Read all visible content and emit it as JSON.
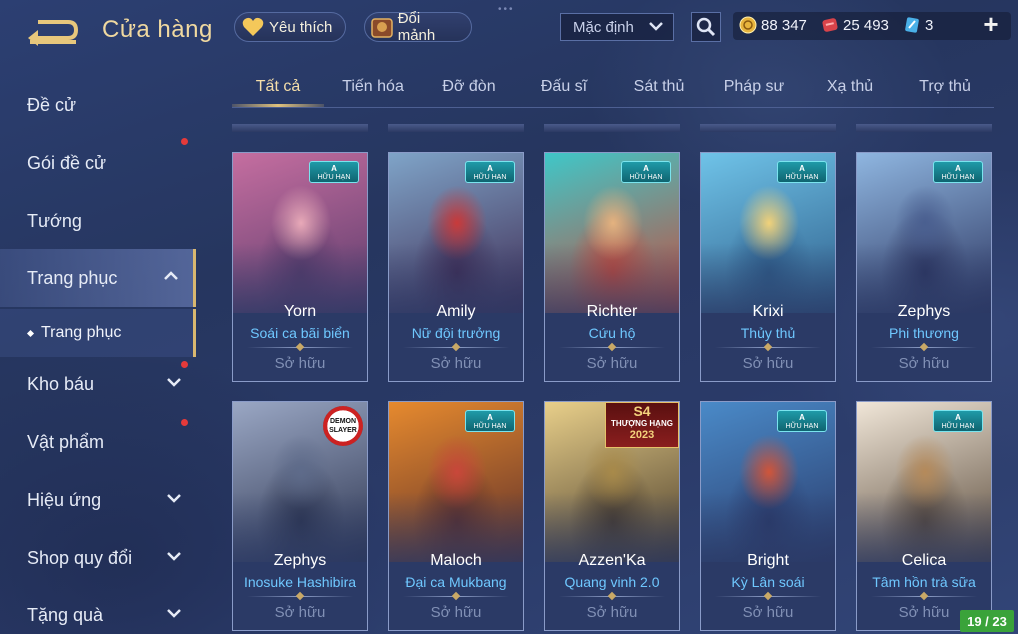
{
  "header": {
    "title": "Cửa hàng",
    "favorites_label": "Yêu thích",
    "shard_exchange_label": "Đổi mảnh",
    "sort": {
      "selected": "Mặc định"
    },
    "currencies": [
      {
        "name": "gold-coin",
        "value": "88 347"
      },
      {
        "name": "ruby-voucher",
        "value": "25 493"
      },
      {
        "name": "skin-ticket",
        "value": "3"
      }
    ]
  },
  "sidebar": {
    "items": [
      {
        "label": "Đề cử"
      },
      {
        "label": "Gói đề cử"
      },
      {
        "label": "Tướng"
      },
      {
        "label": "Trang phục"
      },
      {
        "label": "Kho báu"
      },
      {
        "label": "Vật phẩm"
      },
      {
        "label": "Hiệu ứng"
      },
      {
        "label": "Shop quy đổi"
      },
      {
        "label": "Tặng quà"
      }
    ],
    "sub_item": {
      "label": "Trang phục"
    }
  },
  "tabs": [
    "Tất cả",
    "Tiến hóa",
    "Đỡ đòn",
    "Đấu sĩ",
    "Sát thủ",
    "Pháp sư",
    "Xạ thủ",
    "Trợ thủ"
  ],
  "badges": {
    "limited_rank": "A",
    "limited_text": "HỮU HẠN",
    "demon_slayer": "DEMON SLAYER",
    "season": {
      "s": "S4",
      "t": "THƯỢNG HẠNG",
      "y": "2023"
    }
  },
  "cards": [
    {
      "hero": "Yorn",
      "skin": "Soái ca bãi biển",
      "status": "Sở hữu",
      "badge": "limited",
      "colors": [
        "#c56ea0",
        "#e8a9b8",
        "#5a3b6b"
      ]
    },
    {
      "hero": "Amily",
      "skin": "Nữ đội trưởng",
      "status": "Sở hữu",
      "badge": "limited",
      "colors": [
        "#7fa4c8",
        "#c93a3a",
        "#3f2c54"
      ]
    },
    {
      "hero": "Richter",
      "skin": "Cứu hộ",
      "status": "Sở hữu",
      "badge": "limited",
      "colors": [
        "#3fc7c8",
        "#e4b27f",
        "#c84a3a"
      ]
    },
    {
      "hero": "Krixi",
      "skin": "Thủy thủ",
      "status": "Sở hữu",
      "badge": "limited",
      "colors": [
        "#6fc3e8",
        "#f1d27a",
        "#2e5d8a"
      ]
    },
    {
      "hero": "Zephys",
      "skin": "Phi thương",
      "status": "Sở hữu",
      "badge": "limited",
      "colors": [
        "#8fb6e0",
        "#4a5f90",
        "#2c3560"
      ]
    },
    {
      "hero": "Zephys",
      "skin": "Inosuke Hashibira",
      "status": "Sở hữu",
      "badge": "demon",
      "colors": [
        "#9aa7c4",
        "#5e6b8a",
        "#2d3550"
      ]
    },
    {
      "hero": "Maloch",
      "skin": "Đại ca Mukbang",
      "status": "Sở hữu",
      "badge": "limited",
      "colors": [
        "#e68a2e",
        "#c9473a",
        "#5c2e2a"
      ]
    },
    {
      "hero": "Azzen'Ka",
      "skin": "Quang vinh 2.0",
      "status": "Sở hữu",
      "badge": "season",
      "colors": [
        "#e8cf8a",
        "#a88a4a",
        "#4a3c2a"
      ]
    },
    {
      "hero": "Bright",
      "skin": "Kỳ Lân soái",
      "status": "Sở hữu",
      "badge": "limited",
      "colors": [
        "#4a8ac8",
        "#d0553a",
        "#2a3a6a"
      ]
    },
    {
      "hero": "Celica",
      "skin": "Tâm hồn trà sữa",
      "status": "Sở hữu",
      "badge": "limited",
      "colors": [
        "#f0e6d8",
        "#b58a5a",
        "#5a4a3a"
      ]
    }
  ],
  "pagination": {
    "counter": "19 / 23"
  },
  "colors": {
    "accent_gold": "#d9b870",
    "skin_name_blue": "#6fc8ff",
    "notification_red": "#e53a3a",
    "page_counter_green": "#3aa33a"
  }
}
